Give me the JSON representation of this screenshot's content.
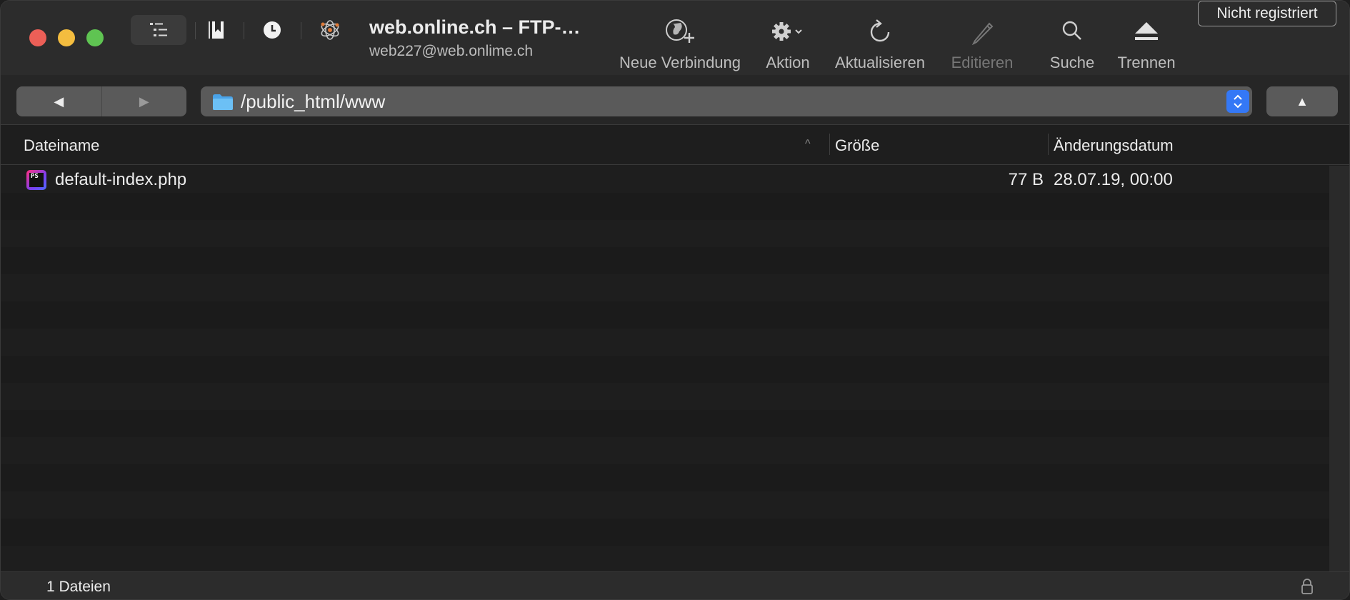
{
  "window": {
    "title": "web.online.ch – FTP-…",
    "subtitle": "web227@web.onlime.ch",
    "registration_badge": "Nicht registriert"
  },
  "toolbar": {
    "new_connection": "Neue Verbindung",
    "action": "Aktion",
    "refresh": "Aktualisieren",
    "edit": "Editieren",
    "search": "Suche",
    "disconnect": "Trennen"
  },
  "navigation": {
    "back_glyph": "◀",
    "forward_glyph": "▶",
    "path": "/public_html/www",
    "up_glyph": "▲"
  },
  "table": {
    "columns": [
      "Dateiname",
      "Größe",
      "Änderungsdatum"
    ],
    "sort_column": "Dateiname",
    "sort_glyph": "^",
    "rows": [
      {
        "name": "default-index.php",
        "size": "77 B",
        "modified": "28.07.19, 00:00",
        "icon": "phpstorm-file-icon",
        "icon_text": "PS"
      }
    ]
  },
  "status": {
    "file_count": "1 Dateien"
  },
  "colors": {
    "close": "#ec5f57",
    "minimize": "#f4bd3f",
    "maximize": "#5fc452",
    "accent": "#3478f6"
  }
}
